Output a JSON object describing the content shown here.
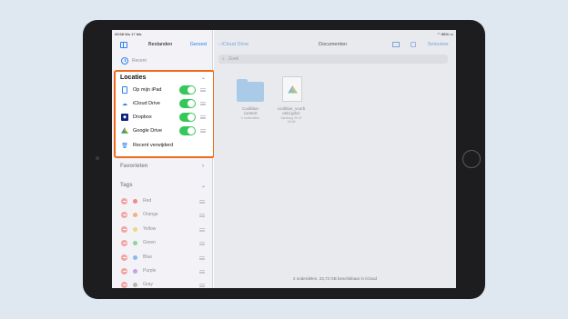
{
  "status": {
    "time": "09:58",
    "date": "Wo 17 feb.",
    "battery": "85%"
  },
  "sidebar": {
    "title": "Bestanden",
    "done": "Gereed",
    "recent": "Recent",
    "locations_title": "Locaties",
    "locations": [
      {
        "label": "Op mijn iPad",
        "icon": "ipad-icon",
        "enabled": true
      },
      {
        "label": "iCloud Drive",
        "icon": "icloud-icon",
        "enabled": true
      },
      {
        "label": "Dropbox",
        "icon": "dropbox-icon",
        "enabled": true
      },
      {
        "label": "Google Drive",
        "icon": "google-drive-icon",
        "enabled": true
      },
      {
        "label": "Recent verwijderd",
        "icon": "trash-icon"
      }
    ],
    "favorites_title": "Favorieten",
    "tags_title": "Tags",
    "tags": [
      {
        "label": "Red",
        "color": "#f08a84"
      },
      {
        "label": "Orange",
        "color": "#f2b27a"
      },
      {
        "label": "Yellow",
        "color": "#f0d77a"
      },
      {
        "label": "Green",
        "color": "#8fd3a0"
      },
      {
        "label": "Blue",
        "color": "#8db8ec"
      },
      {
        "label": "Purple",
        "color": "#c9a0e3"
      },
      {
        "label": "Gray",
        "color": "#b5b5ba"
      }
    ]
  },
  "main": {
    "back": "iCloud Drive",
    "title": "Documenten",
    "select": "Selecteer",
    "search_placeholder": "Zoek",
    "files": [
      {
        "name_line1": "Coolblue",
        "name_line2": "content",
        "meta_line1": "3 onderdelen",
        "meta_line2": ""
      },
      {
        "name_line1": "coolblue_voorb",
        "name_line2": "eeld.gdoc",
        "meta_line1": "Vandaag 09:47",
        "meta_line2": "18 kB"
      }
    ],
    "footer": "2 onderdelen, 23,72 GB beschikbaar in iCloud"
  },
  "colors": {
    "accent": "#2f80ed",
    "highlight": "#f06a1c",
    "toggle_on": "#34c759"
  }
}
